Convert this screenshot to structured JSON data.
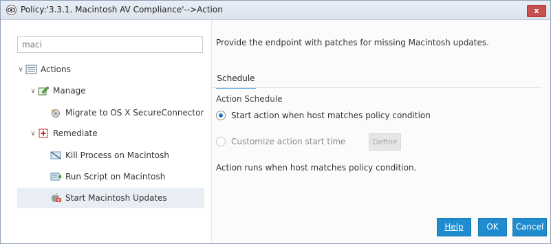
{
  "window": {
    "title": "Policy:'3.3.1. Macintosh AV Compliance'-->Action",
    "close_label": "x",
    "icon": "policy-eye-icon"
  },
  "left": {
    "search_value": "maci",
    "tree": {
      "actions": {
        "label": "Actions",
        "icon": "list-icon"
      },
      "manage": {
        "label": "Manage",
        "icon": "manage-pencil-icon"
      },
      "migrate": {
        "label": "Migrate to OS X SecureConnector",
        "icon": "migrate-icon"
      },
      "remediate": {
        "label": "Remediate",
        "icon": "remediate-plus-icon"
      },
      "kill": {
        "label": "Kill Process on Macintosh",
        "icon": "kill-process-icon"
      },
      "run": {
        "label": "Run Script on Macintosh",
        "icon": "run-script-icon"
      },
      "start": {
        "label": "Start Macintosh Updates",
        "icon": "apple-updates-icon"
      }
    }
  },
  "right": {
    "description": "Provide the endpoint with patches for missing Macintosh updates.",
    "tab_schedule": "Schedule",
    "section_label": "Action Schedule",
    "radio_start": "Start action when host matches policy condition",
    "radio_customize": "Customize action start time",
    "define_label": "Define",
    "info": "Action runs when host matches policy condition."
  },
  "footer": {
    "help_label": "Help",
    "ok_label": "OK",
    "cancel_label": "Cancel"
  },
  "colors": {
    "accent": "#1e8ccf",
    "selection": "#e8eef3",
    "tab_underline": "#4aa3df",
    "close": "#c75050"
  }
}
